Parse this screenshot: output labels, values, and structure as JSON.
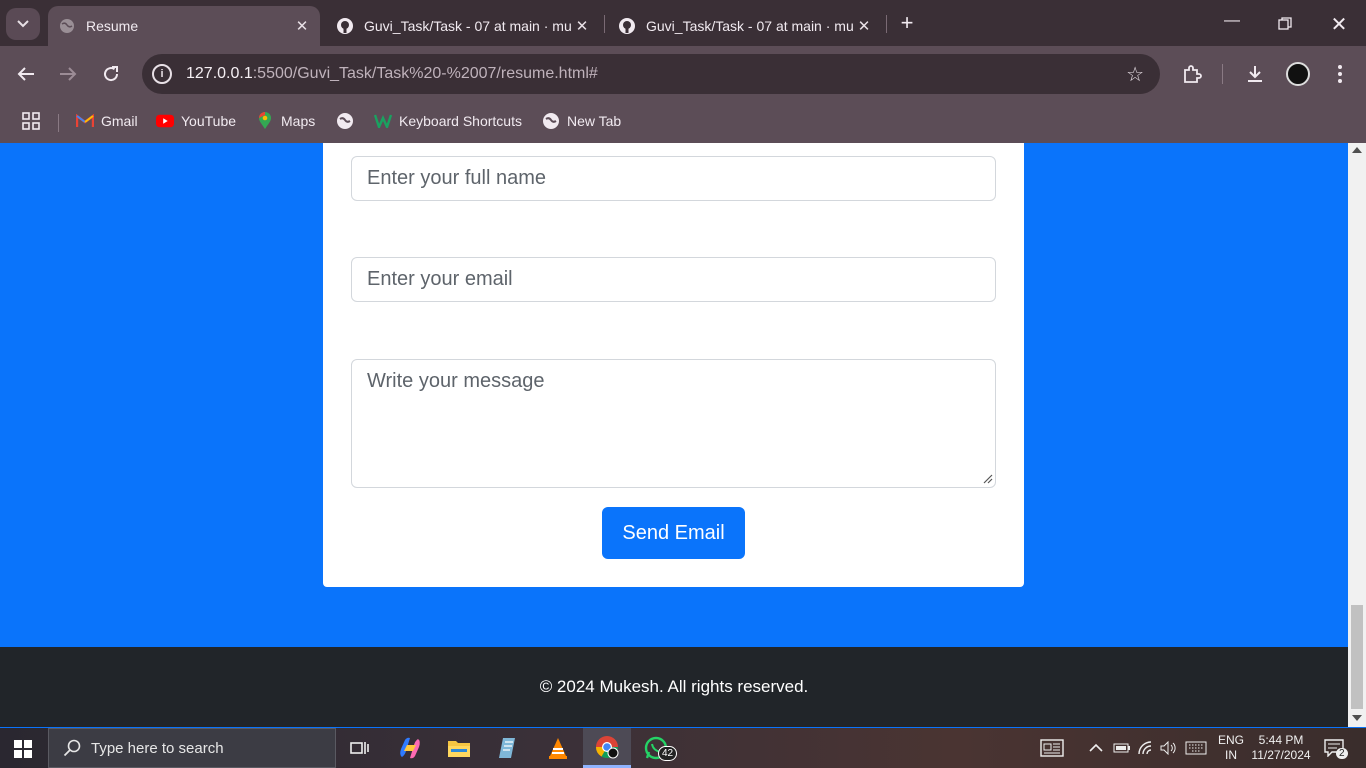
{
  "browser": {
    "tabs": [
      {
        "title": "Resume",
        "active": true
      },
      {
        "title": "Guvi_Task/Task - 07 at main · mu",
        "active": false
      },
      {
        "title": "Guvi_Task/Task - 07 at main · mu",
        "active": false
      }
    ],
    "url_host": "127.0.0.1",
    "url_rest": ":5500/Guvi_Task/Task%20-%2007/resume.html#",
    "bookmarks": [
      "Gmail",
      "YouTube",
      "Maps",
      "Keyboard Shortcuts",
      "New Tab"
    ]
  },
  "form": {
    "name_placeholder": "Enter your full name",
    "email_placeholder": "Enter your email",
    "message_placeholder": "Write your message",
    "send_label": "Send Email"
  },
  "footer": {
    "text": "© 2024 Mukesh. All rights reserved."
  },
  "taskbar": {
    "search_placeholder": "Type here to search",
    "whatsapp_badge": "42",
    "lang_top": "ENG",
    "lang_bottom": "IN",
    "time": "5:44 PM",
    "date": "11/27/2024",
    "notifications": "2"
  },
  "colors": {
    "page_bg": "#0a74fb",
    "button": "#0a74fb",
    "footer": "#212529"
  }
}
